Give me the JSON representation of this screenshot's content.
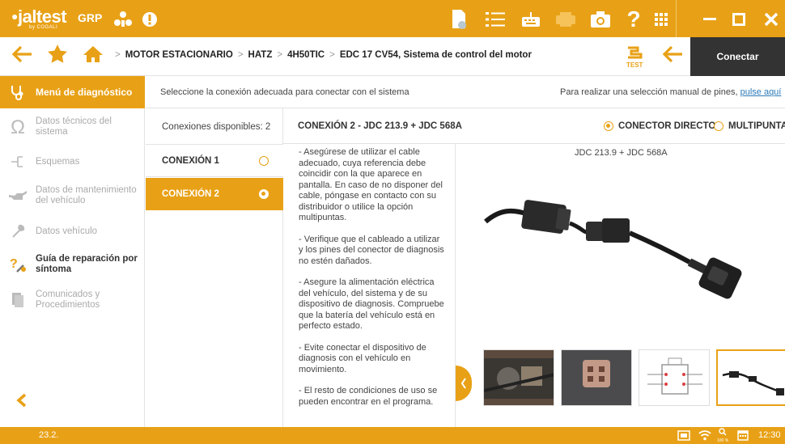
{
  "app": {
    "logo": "jaltest",
    "logo_sub": "by COGALI",
    "group": "GRP"
  },
  "toolbar": {
    "connect_label": "Conectar"
  },
  "breadcrumb": [
    "MOTOR ESTACIONARIO",
    "HATZ",
    "4H50TIC",
    "EDC 17 CV54, Sistema de control del motor"
  ],
  "sidebar": {
    "header": "Menú de diagnóstico",
    "items": [
      {
        "label": "Datos técnicos del sistema",
        "icon": "omega-icon",
        "enabled": false
      },
      {
        "label": "Esquemas",
        "icon": "schematic-icon",
        "enabled": false
      },
      {
        "label": "Datos de mantenimiento del vehículo",
        "icon": "oil-can-icon",
        "enabled": false
      },
      {
        "label": "Datos vehículo",
        "icon": "wrench-icon",
        "enabled": false
      },
      {
        "label": "Guía de reparación por síntoma",
        "icon": "repair-guide-icon",
        "enabled": true
      },
      {
        "label": "Comunicados y Procedimientos",
        "icon": "documents-icon",
        "enabled": false
      }
    ]
  },
  "info": {
    "text": "Seleccione la conexión adecuada para conectar con el sistema",
    "manual_prefix": "Para realizar una selección manual de pines,",
    "manual_link": "pulse aquí"
  },
  "connections": {
    "available_label": "Conexiones disponibles: 2",
    "items": [
      {
        "label": "CONEXIÓN 1",
        "selected": false
      },
      {
        "label": "CONEXIÓN 2",
        "selected": true
      }
    ]
  },
  "detail": {
    "title": "CONEXIÓN 2 - JDC 213.9 + JDC 568A",
    "option_direct": "CONECTOR DIRECTO",
    "option_multi": "MULTIPUNTAS",
    "image_caption": "JDC 213.9 + JDC 568A",
    "instructions": [
      "- Asegúrese de utilizar el cable adecuado, cuya referencia debe coincidir con la que aparece en pantalla. En caso de no disponer del cable, póngase en contacto con su distribuidor o utilice la opción multipuntas.",
      "- Verifique que el cableado a utilizar y los pines del conector de diagnosis no estén dañados.",
      "- Asegure la alimentación eléctrica del vehículo, del sistema y de su dispositivo de diagnosis. Compruebe que la batería del vehículo está en perfecto estado.",
      "- Evite conectar el dispositivo de diagnosis con el vehículo en movimiento.",
      "- El resto de condiciones de uso se pueden encontrar en el programa."
    ]
  },
  "status": {
    "version": "23.2.",
    "zoom": "100 %",
    "time": "12:30"
  },
  "colors": {
    "accent": "#e8a116",
    "dark": "#333333"
  }
}
